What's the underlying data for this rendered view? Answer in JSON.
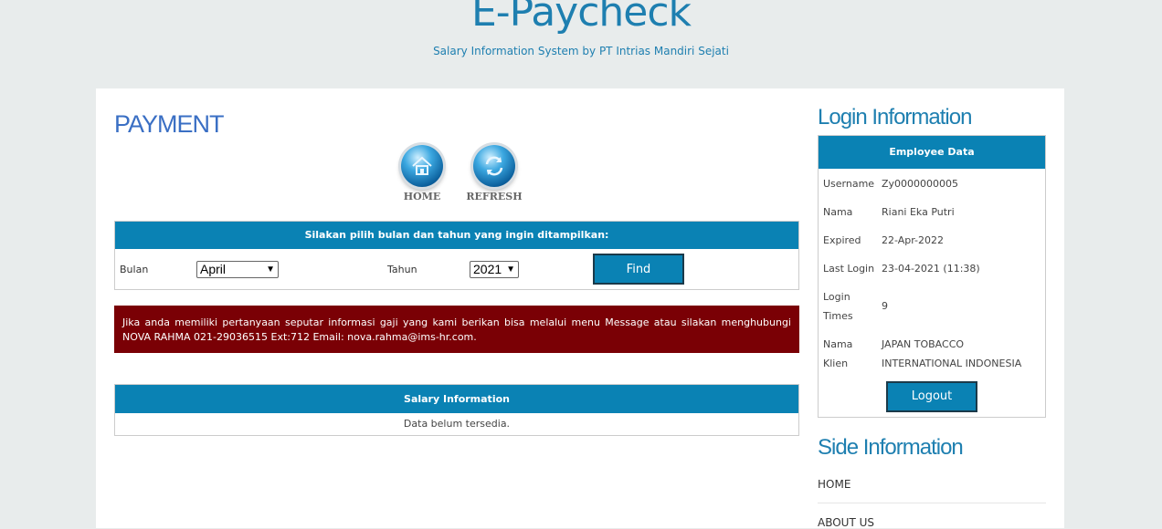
{
  "header": {
    "title": "E-Paycheck",
    "subtitle": "Salary Information System by PT Intrias Mandiri Sejati"
  },
  "main": {
    "page_title": "PAYMENT",
    "icons": {
      "home_label": "HOME",
      "refresh_label": "REFRESH"
    },
    "filter": {
      "header": "Silakan pilih bulan dan tahun yang ingin ditampilkan:",
      "month_label": "Bulan",
      "month_value": "April",
      "year_label": "Tahun",
      "year_value": "2021",
      "find_label": "Find"
    },
    "alert": "Jika anda memiliki pertanyaan seputar informasi gaji yang kami berikan bisa melalui menu Message atau silakan menghubungi NOVA RAHMA 021-29036515 Ext:712 Email: nova.rahma@ims-hr.com.",
    "salary": {
      "header": "Salary Information",
      "empty_text": "Data belum tersedia."
    }
  },
  "sidebar": {
    "login_heading": "Login Information",
    "employee_header": "Employee Data",
    "fields": [
      {
        "key": "Username",
        "value": "Zy0000000005"
      },
      {
        "key": "Nama",
        "value": "Riani Eka Putri"
      },
      {
        "key": "Expired",
        "value": "22-Apr-2022"
      },
      {
        "key": "Last Login",
        "value": "23-04-2021 (11:38)"
      },
      {
        "key": "Login Times",
        "value": "9"
      },
      {
        "key": "Nama Klien",
        "value": "JAPAN TOBACCO INTERNATIONAL INDONESIA"
      }
    ],
    "logout_label": "Logout",
    "side_heading": "Side Information",
    "links": [
      "HOME",
      "ABOUT US"
    ]
  },
  "colors": {
    "accent": "#0a82b4",
    "title": "#1e7fb0",
    "alert_bg": "#7a0005",
    "page_bg": "#e8ecec"
  }
}
